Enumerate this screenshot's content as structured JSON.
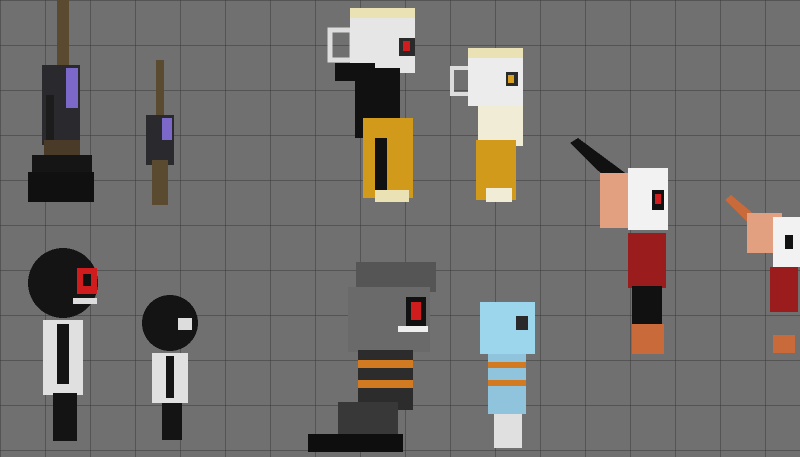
{
  "scene": {
    "type": "sandbox-playground",
    "background_color": "#707070",
    "grid_line_color": "#3c3c3c"
  },
  "characters": [
    {
      "id": "broom-large",
      "icon": "broom-character-icon"
    },
    {
      "id": "broom-small",
      "icon": "broom-character-icon"
    },
    {
      "id": "cup-large",
      "icon": "cup-character-icon"
    },
    {
      "id": "cup-small",
      "icon": "cup-character-icon"
    },
    {
      "id": "funnel-large",
      "icon": "funnel-character-icon"
    },
    {
      "id": "funnel-small",
      "icon": "funnel-character-icon"
    },
    {
      "id": "ball-large",
      "icon": "ball-head-character-icon"
    },
    {
      "id": "ball-small",
      "icon": "ball-head-character-icon"
    },
    {
      "id": "bucket",
      "icon": "bucket-character-icon"
    },
    {
      "id": "glass",
      "icon": "glass-character-icon"
    }
  ]
}
